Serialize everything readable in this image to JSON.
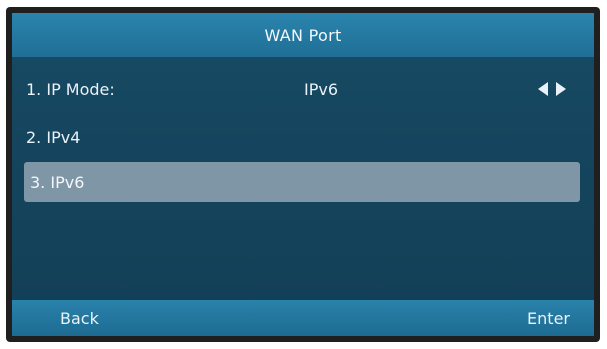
{
  "title": "WAN Port",
  "menu": {
    "items": [
      {
        "label": "1. IP Mode:",
        "value": "IPv6"
      },
      {
        "label": "2. IPv4"
      },
      {
        "label": "3. IPv6"
      }
    ],
    "selected_index": 2
  },
  "softkeys": {
    "left": "Back",
    "right": "Enter"
  },
  "icons": {
    "left_arrow": "triangle-left-icon",
    "right_arrow": "triangle-right-icon"
  },
  "colors": {
    "title_bar": "#2a84ad",
    "background": "#15455e",
    "highlight": "#7e96a6",
    "softkey_bar": "#2a82ab"
  }
}
